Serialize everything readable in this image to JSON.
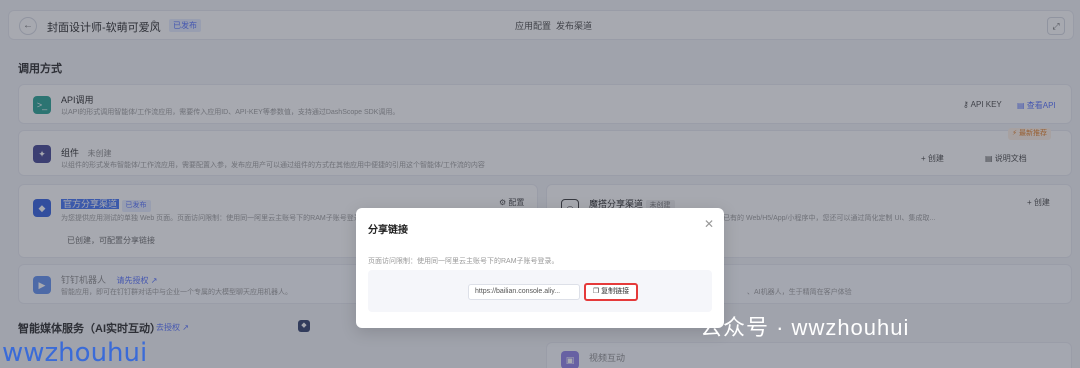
{
  "header": {
    "back_icon": "←",
    "title": "封面设计师-软萌可爱风",
    "edit_icon": "✎",
    "status": "已发布",
    "tab_config": "应用配置",
    "tab_publish": "发布渠道",
    "expand_icon": "⤢"
  },
  "section": {
    "title": "调用方式"
  },
  "api_card": {
    "icon": ">_",
    "title": "API调用",
    "desc": "以API的形式调用智能体/工作流应用，需要传入应用ID、API-KEY等参数值，支持通过DashScope SDK调用。",
    "api_key": "API KEY",
    "view_api": "查看API"
  },
  "widget_card": {
    "icon": "✦",
    "title": "组件",
    "status": "未创建",
    "desc": "以组件的形式发布智能体/工作流应用，需要配置入参，发布应用产可以通过组件的方式在其他应用中便捷的引用这个智能体/工作流的内容",
    "badge": "⚡ 最新推荐",
    "create": "+ 创建",
    "doc": "说明文档"
  },
  "official_card": {
    "title": "官方分享渠道",
    "status": "已发布",
    "desc": "为您提供应用测试的单独 Web 页面。页面访问限制：使用同一阿里云主账号下的RAM子账号登录",
    "config": "⚙ 配置",
    "note": "已创建，可配置分享链接"
  },
  "magic_card": {
    "title": "魔搭分享渠道",
    "status": "未创建",
    "desc": "将应用发布为生产级 Web/H5 应用，或嵌入已有的 Web/H5/App/小程序中，您还可以通过简化定制 UI、集成取...",
    "create": "+ 创建"
  },
  "ai_card": {
    "title": "钉钉机器人",
    "link": "请先授权 ↗",
    "desc": "智能应用，即可在钉钉群对话中与企业一个专属的大模型聊天应用机器人。"
  },
  "ai_card2": {
    "desc": "、AI机器人，生于精简在客户体验"
  },
  "media": {
    "title": "智能媒体服务（AI实时互动）",
    "link": "去授权 ↗",
    "icon": "◆",
    "video_title": "视频互动"
  },
  "modal": {
    "title": "分享链接",
    "close_icon": "✕",
    "desc": "页面访问限制：使用同一阿里云主账号下的RAM子账号登录。",
    "url": "https://bailian.console.aliy...",
    "copy_icon": "❐",
    "copy_label": "复制链接"
  },
  "watermarks": {
    "wechat": "公众号 · wwzhouhui",
    "left": "wwzhouhui"
  }
}
